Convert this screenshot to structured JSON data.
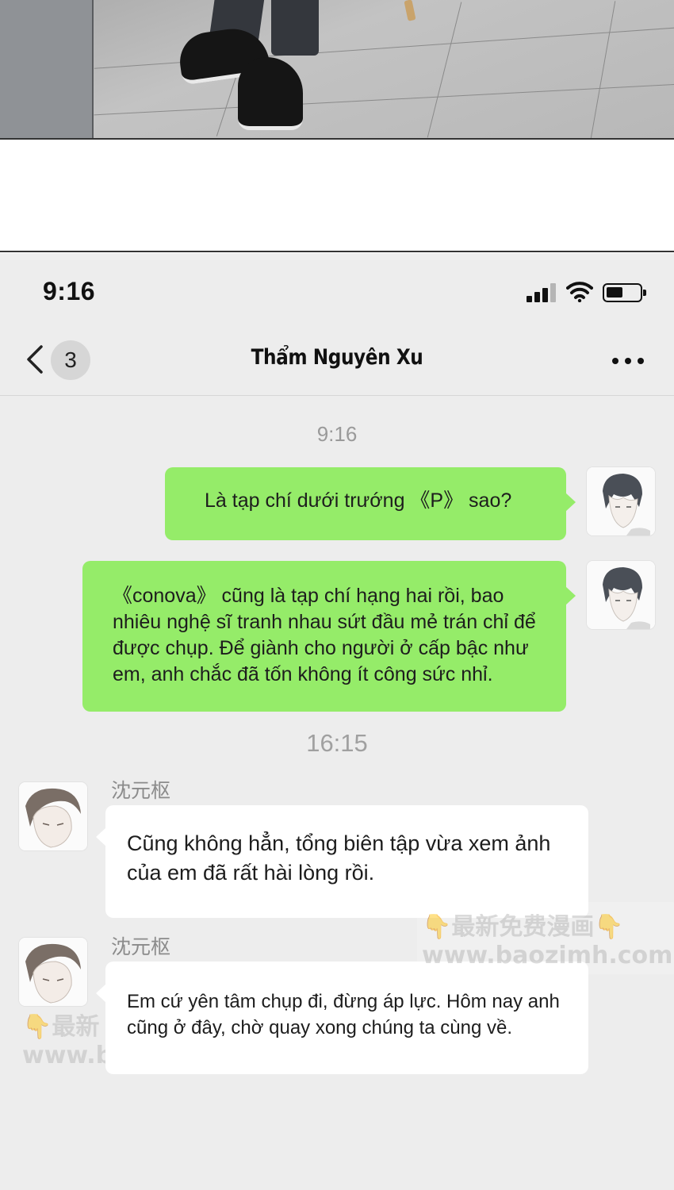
{
  "status_bar": {
    "time": "9:16"
  },
  "nav": {
    "unread_count": "3",
    "title": "Thẩm Nguyên Xu"
  },
  "messages": {
    "timestamp_1": "9:16",
    "sent_1": "Là tạp chí dưới trướng 《P》 sao?",
    "sent_2": "《conova》 cũng là tạp chí hạng hai rồi, bao nhiêu nghệ sĩ tranh nhau sứt đầu mẻ trán chỉ để được chụp. Để giành cho người ở cấp bậc như em, anh chắc đã tốn không ít công sức nhỉ.",
    "timestamp_2": "16:15",
    "sender_name_1": "沈元枢",
    "received_1": "Cũng không hẳn, tổng biên tập vừa xem ảnh của em đã rất hài lòng rồi.",
    "sender_name_2": "沈元枢",
    "received_2": "Em cứ yên tâm chụp đi, đừng áp lực. Hôm nay anh cũng ở đây, chờ quay xong chúng ta cùng về."
  },
  "watermark": {
    "line1": "最新免费漫画",
    "line2": "www.baozimh.com",
    "partial_line1": "最新",
    "partial_line2": "www.b",
    "hand_glyph": "👇"
  },
  "colors": {
    "sent_bubble": "#95ec69",
    "received_bubble": "#ffffff",
    "chat_background": "#ededed"
  }
}
